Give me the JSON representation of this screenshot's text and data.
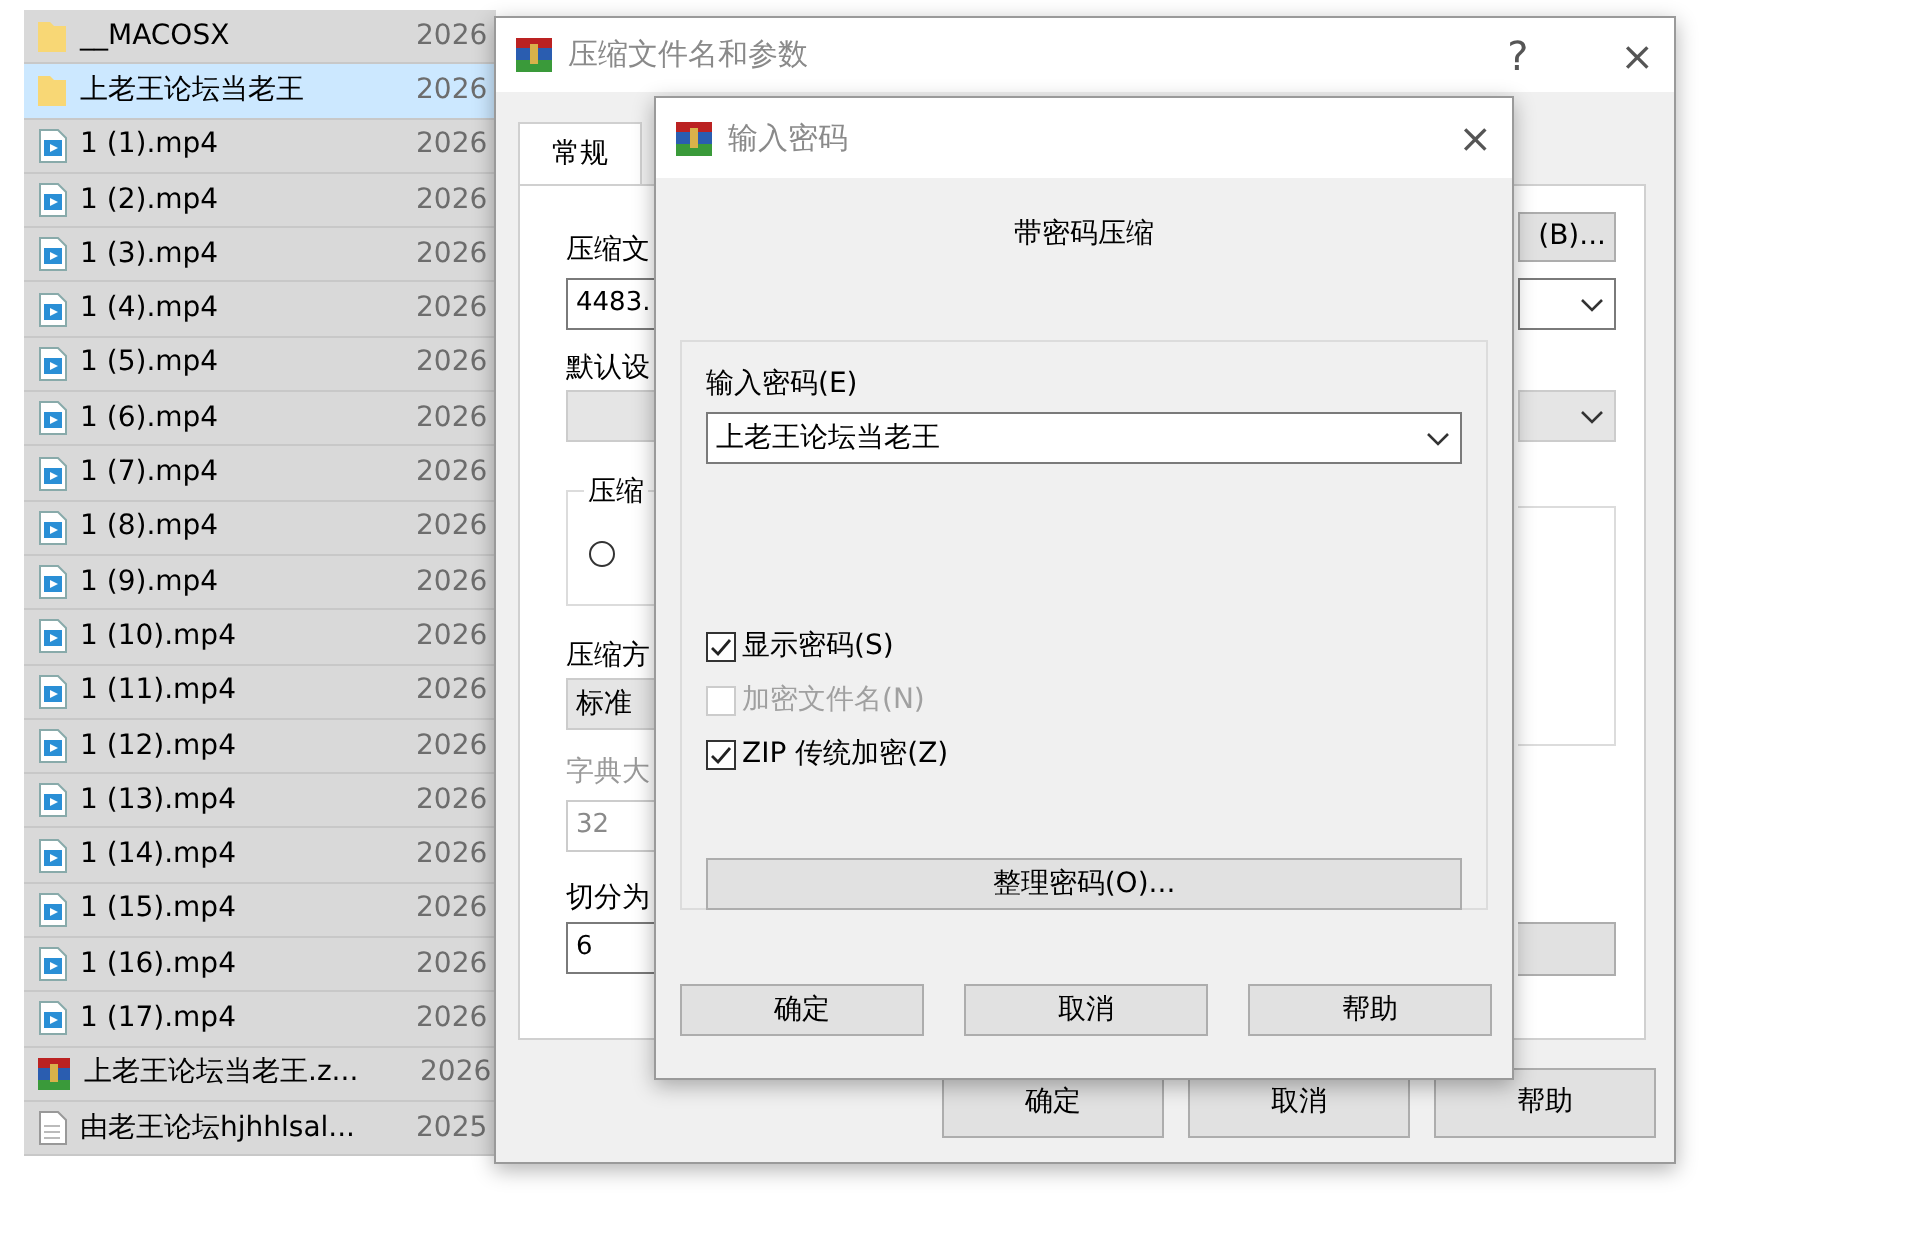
{
  "file_list": {
    "rows": [
      {
        "name": "__MACOSX",
        "date": "2026",
        "kind": "folder",
        "selected": true,
        "focused": false
      },
      {
        "name": "上老王论坛当老王",
        "date": "2026",
        "kind": "folder",
        "selected": true,
        "focused": true
      },
      {
        "name": "1 (1).mp4",
        "date": "2026",
        "kind": "video",
        "selected": true,
        "focused": false
      },
      {
        "name": "1 (2).mp4",
        "date": "2026",
        "kind": "video",
        "selected": true,
        "focused": false
      },
      {
        "name": "1 (3).mp4",
        "date": "2026",
        "kind": "video",
        "selected": true,
        "focused": false
      },
      {
        "name": "1 (4).mp4",
        "date": "2026",
        "kind": "video",
        "selected": true,
        "focused": false
      },
      {
        "name": "1 (5).mp4",
        "date": "2026",
        "kind": "video",
        "selected": true,
        "focused": false
      },
      {
        "name": "1 (6).mp4",
        "date": "2026",
        "kind": "video",
        "selected": true,
        "focused": false
      },
      {
        "name": "1 (7).mp4",
        "date": "2026",
        "kind": "video",
        "selected": true,
        "focused": false
      },
      {
        "name": "1 (8).mp4",
        "date": "2026",
        "kind": "video",
        "selected": true,
        "focused": false
      },
      {
        "name": "1 (9).mp4",
        "date": "2026",
        "kind": "video",
        "selected": true,
        "focused": false
      },
      {
        "name": "1 (10).mp4",
        "date": "2026",
        "kind": "video",
        "selected": true,
        "focused": false
      },
      {
        "name": "1 (11).mp4",
        "date": "2026",
        "kind": "video",
        "selected": true,
        "focused": false
      },
      {
        "name": "1 (12).mp4",
        "date": "2026",
        "kind": "video",
        "selected": true,
        "focused": false
      },
      {
        "name": "1 (13).mp4",
        "date": "2026",
        "kind": "video",
        "selected": true,
        "focused": false
      },
      {
        "name": "1 (14).mp4",
        "date": "2026",
        "kind": "video",
        "selected": true,
        "focused": false
      },
      {
        "name": "1 (15).mp4",
        "date": "2026",
        "kind": "video",
        "selected": true,
        "focused": false
      },
      {
        "name": "1 (16).mp4",
        "date": "2026",
        "kind": "video",
        "selected": true,
        "focused": false
      },
      {
        "name": "1 (17).mp4",
        "date": "2026",
        "kind": "video",
        "selected": true,
        "focused": false
      },
      {
        "name": "上老王论坛当老王.z...",
        "date": "2026",
        "kind": "archive",
        "selected": true,
        "focused": false
      },
      {
        "name": "由老王论坛hjhhlsal...",
        "date": "2025",
        "kind": "text",
        "selected": true,
        "focused": false
      }
    ]
  },
  "archive_dialog": {
    "title": "压缩文件名和参数",
    "help_glyph": "?",
    "close_glyph": "×",
    "tabs": [
      {
        "label": "常规",
        "selected": true
      }
    ],
    "archive_name_label": "压缩文",
    "archive_name_value": "4483.",
    "browse_button": "(B)...",
    "profile_label": "默认设",
    "update_group_label": "压缩",
    "update_radio_selected": false,
    "method_label": "压缩方",
    "method_value": "标准",
    "dictionary_label": "字典大",
    "dictionary_value": "32",
    "dictionary_disabled": true,
    "split_label": "切分为",
    "split_value": "6",
    "buttons": [
      "确定",
      "取消",
      "帮助"
    ]
  },
  "password_dialog": {
    "title": "输入密码",
    "close_glyph": "×",
    "heading": "带密码压缩",
    "password_label": "输入密码(E)",
    "password_value": "上老王论坛当老王",
    "options": [
      {
        "label": "显示密码(S)",
        "checked": true,
        "disabled": false
      },
      {
        "label": "加密文件名(N)",
        "checked": false,
        "disabled": true
      },
      {
        "label": "ZIP 传统加密(Z)",
        "checked": true,
        "disabled": false
      }
    ],
    "organize_button": "整理密码(O)...",
    "buttons": [
      "确定",
      "取消",
      "帮助"
    ]
  }
}
